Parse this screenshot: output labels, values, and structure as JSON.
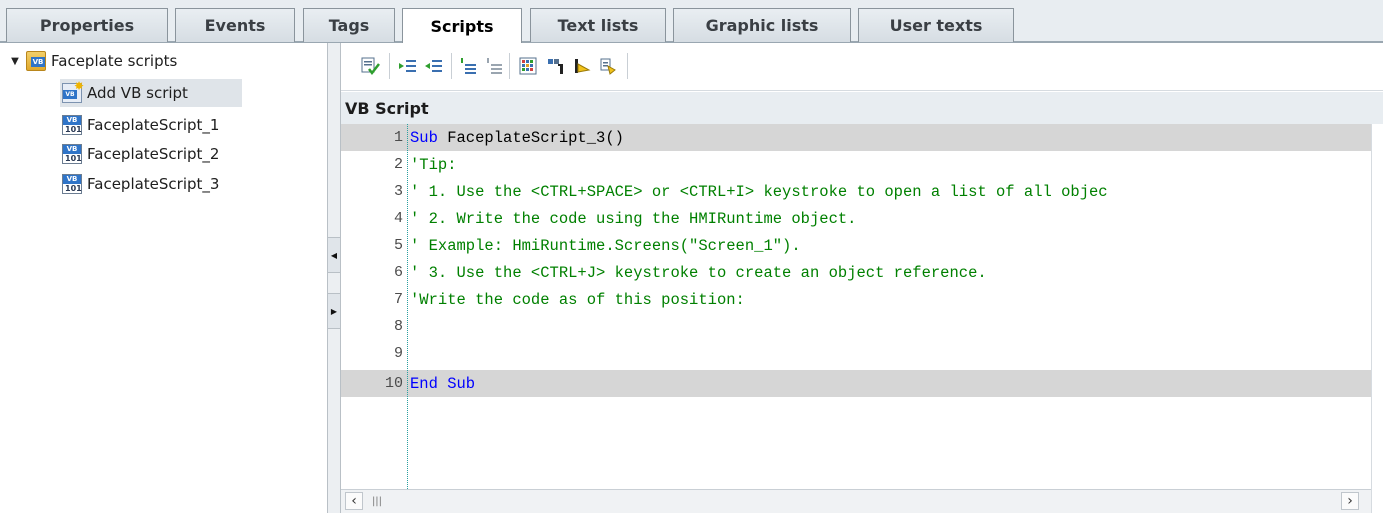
{
  "tabs": [
    {
      "label": "Properties",
      "active": false
    },
    {
      "label": "Events",
      "active": false
    },
    {
      "label": "Tags",
      "active": false
    },
    {
      "label": "Scripts",
      "active": true
    },
    {
      "label": "Text lists",
      "active": false
    },
    {
      "label": "Graphic lists",
      "active": false
    },
    {
      "label": "User texts",
      "active": false
    }
  ],
  "tree": {
    "root": {
      "label": "Faceplate scripts",
      "icon": "vb-folder-icon",
      "expanded": true
    },
    "items": [
      {
        "label": "Add VB script",
        "icon": "add-vb-script-icon",
        "selected": true
      },
      {
        "label": "FaceplateScript_1",
        "icon": "vb-script-icon"
      },
      {
        "label": "FaceplateScript_2",
        "icon": "vb-script-icon"
      },
      {
        "label": "FaceplateScript_3",
        "icon": "vb-script-icon"
      }
    ]
  },
  "toolbar": {
    "buttons": [
      "syntax-check-icon",
      "indent-icon",
      "outdent-icon",
      "comment-icon",
      "uncomment-icon",
      "object-list-icon",
      "object-reference-icon",
      "bookmark-icon",
      "bookmark-next-icon"
    ]
  },
  "editor": {
    "header": "VB Script",
    "lines": [
      {
        "num": "1",
        "keyword": "Sub",
        "rest": " FaceplateScript_3()",
        "highlight": true
      },
      {
        "num": "2",
        "comment": "'Tip:"
      },
      {
        "num": "3",
        "comment": "' 1. Use the <CTRL+SPACE> or <CTRL+I> keystroke to open a list of all objec"
      },
      {
        "num": "4",
        "comment": "' 2. Write the code using the HMIRuntime object."
      },
      {
        "num": "5",
        "comment": "' Example: HmiRuntime.Screens(\"Screen_1\")."
      },
      {
        "num": "6",
        "comment": "' 3. Use the <CTRL+J> keystroke to create an object reference."
      },
      {
        "num": "7",
        "comment": "'Write the code as of this position:"
      },
      {
        "num": "8",
        "comment": ""
      },
      {
        "num": "9",
        "comment": ""
      },
      {
        "num": "10",
        "keyword": "End Sub",
        "rest": "",
        "highlight": true
      }
    ]
  },
  "colors": {
    "comment": "#008000",
    "keyword": "#0000ff",
    "highlight_row": "#d6d6d6"
  }
}
